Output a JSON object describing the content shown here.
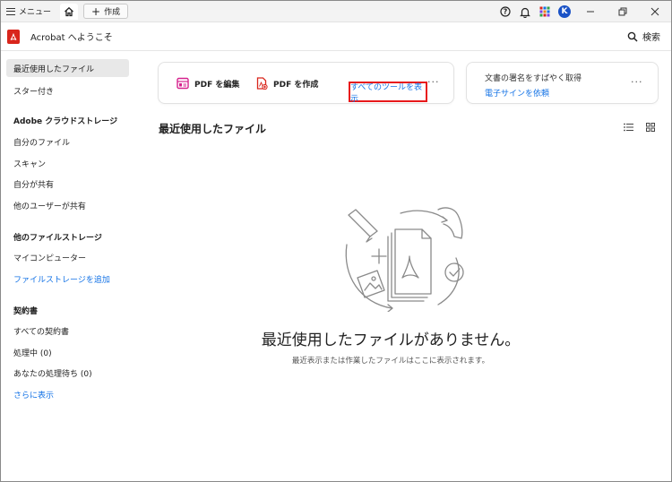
{
  "titlebar": {
    "menu_label": "メニュー",
    "create_tab_label": "作成",
    "avatar_initial": "K"
  },
  "app": {
    "title": "Acrobat へようこそ",
    "search_label": "検索",
    "brand_color": "#d9261c",
    "link_color": "#1473e6"
  },
  "sidebar": {
    "recent": "最近使用したファイル",
    "starred": "スター付き",
    "adobe_storage_heading": "Adobe クラウドストレージ",
    "my_files": "自分のファイル",
    "scans": "スキャン",
    "shared_by_me": "自分が共有",
    "shared_by_others": "他のユーザーが共有",
    "other_storage_heading": "他のファイルストレージ",
    "my_computer": "マイコンピューター",
    "add_storage": "ファイルストレージを追加",
    "agreements_heading": "契約書",
    "all_agreements": "すべての契約書",
    "in_progress": "処理中 (0)",
    "waiting_for_you": "あなたの処理待ち (0)",
    "show_more": "さらに表示"
  },
  "tools_card": {
    "edit_pdf": "PDF を編集",
    "create_pdf": "PDF を作成",
    "show_all_tools": "すべてのツールを表示",
    "more": "···"
  },
  "sign_card": {
    "title": "文書の署名をすばやく取得",
    "link": "電子サインを依頼",
    "more": "···"
  },
  "recent": {
    "heading": "最近使用したファイル",
    "empty_title": "最近使用したファイルがありません。",
    "empty_subtitle": "最近表示または作業したファイルはここに表示されます。"
  }
}
